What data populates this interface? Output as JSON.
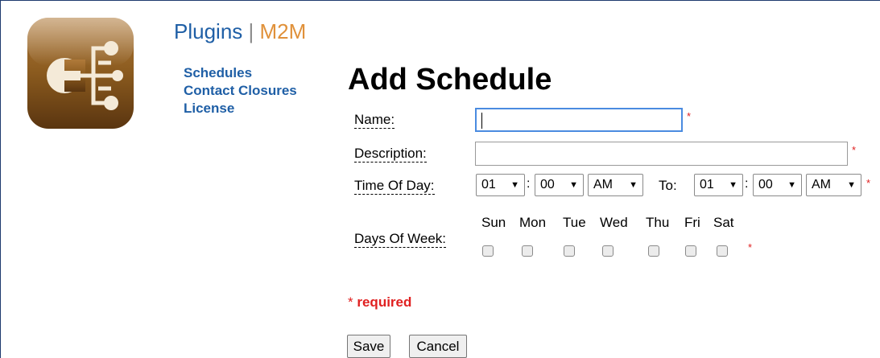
{
  "header": {
    "plugins_label": "Plugins",
    "separator": "|",
    "plugin_name": "M2M"
  },
  "nav": {
    "items": [
      {
        "label": "Schedules"
      },
      {
        "label": "Contact Closures"
      },
      {
        "label": "License"
      }
    ]
  },
  "page": {
    "heading": "Add Schedule"
  },
  "form": {
    "required_marker": "*",
    "name_label": "Name:",
    "name_value": "",
    "description_label": "Description:",
    "description_value": "",
    "time_label": "Time Of Day:",
    "time_separator": ":",
    "from_hour": "01",
    "from_minute": "00",
    "from_ampm": "AM",
    "to_label": "To:",
    "to_hour": "01",
    "to_minute": "00",
    "to_ampm": "AM",
    "days_label": "Days Of Week:",
    "days": [
      "Sun",
      "Mon",
      "Tue",
      "Wed",
      "Thu",
      "Fri",
      "Sat"
    ],
    "days_checked": [
      false,
      false,
      false,
      false,
      false,
      false,
      false
    ],
    "required_note_star": "*",
    "required_note_text": "required"
  },
  "buttons": {
    "save_label": "Save",
    "cancel_label": "Cancel"
  },
  "colors": {
    "link_blue": "#1f5fa6",
    "accent_orange": "#e0913a",
    "required_red": "#e02020",
    "logo_brown": "#8a5a1e"
  },
  "icons": {
    "logo": "m2m-plugin-logo-icon",
    "dropdown": "dropdown-arrow-icon"
  }
}
